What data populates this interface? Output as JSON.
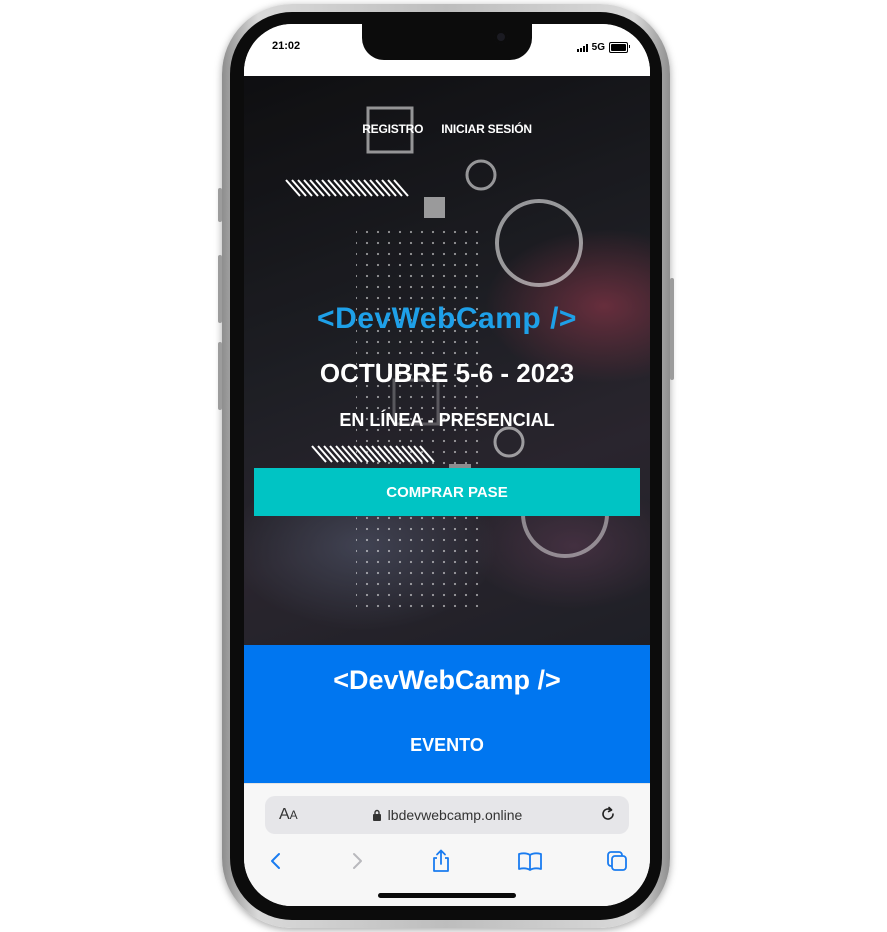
{
  "status_bar": {
    "time": "21:02",
    "network": "5G"
  },
  "hero": {
    "nav": {
      "register": "REGISTRO",
      "login": "INICIAR SESIÓN"
    },
    "logo": "<DevWebCamp />",
    "date": "OCTUBRE 5-6 - 2023",
    "place": "EN LÍNEA - PRESENCIAL",
    "cta": "COMPRAR PASE",
    "colors": {
      "logo": "#1ea0e8",
      "cta_bg": "#00c4c4"
    }
  },
  "section": {
    "logo": "<DevWebCamp />",
    "heading": "EVENTO",
    "color": "#0076f0"
  },
  "browser": {
    "text_size_label": "AA",
    "url": "lbdevwebcamp.online",
    "icons": [
      "lock-icon",
      "reload-icon",
      "back-icon",
      "forward-icon",
      "share-icon",
      "bookmarks-icon",
      "tabs-icon"
    ]
  }
}
